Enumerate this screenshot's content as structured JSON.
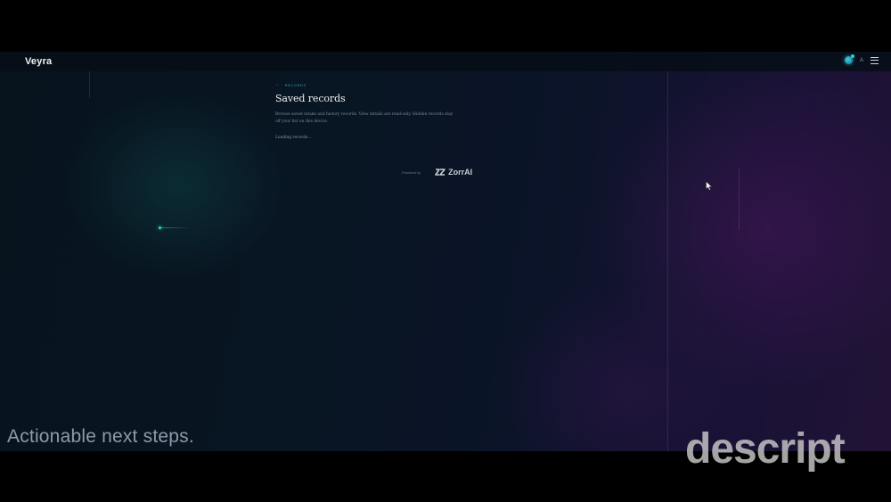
{
  "app": {
    "brand": "Veyra",
    "language_label": "A"
  },
  "header": {
    "back_label": "RECORDS",
    "title": "Saved records",
    "description": "Browse saved intake and history records. View details are read-only. Hidden records stay off your list on this device.",
    "loading_text": "Loading records..."
  },
  "footer": {
    "powered_by_label": "Powered by",
    "provider_name": "ZorrAI"
  },
  "overlay": {
    "caption": "Actionable next steps.",
    "watermark": "descript"
  },
  "colors": {
    "accent": "#2fa7b8",
    "glow": "#2fe0c6",
    "background_left": "#07141e",
    "background_right": "#211336"
  },
  "icons": [
    "avatar-icon",
    "menu-icon",
    "back-arrow-icon",
    "zorrai-logo-icon",
    "cursor-icon"
  ]
}
